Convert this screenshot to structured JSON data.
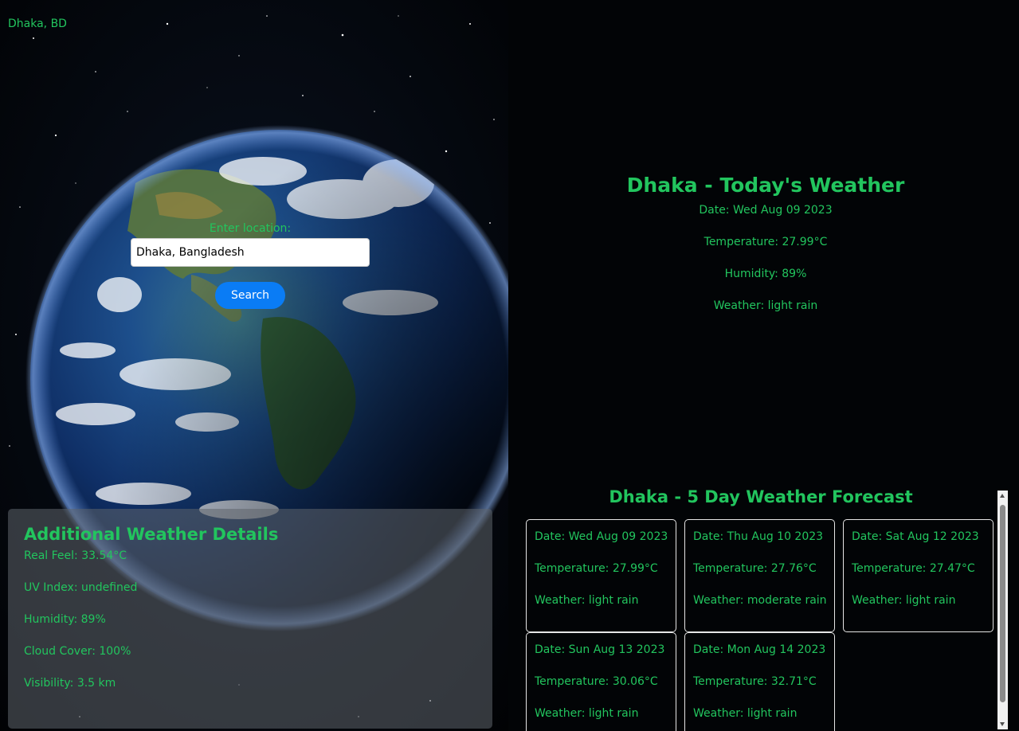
{
  "location_label": "Dhaka, BD",
  "search": {
    "prompt": "Enter location:",
    "value": "Dhaka, Bangladesh",
    "button_label": "Search"
  },
  "additional_details": {
    "title": "Additional Weather Details",
    "lines": [
      "Real Feel: 33.54°C",
      "UV Index: undefined",
      "Humidity: 89%",
      "Cloud Cover: 100%",
      "Visibility: 3.5 km"
    ]
  },
  "today": {
    "title": "Dhaka - Today's Weather",
    "date": "Date: Wed Aug 09 2023",
    "temperature": "Temperature: 27.99°C",
    "humidity": "Humidity: 89%",
    "weather": "Weather: light rain"
  },
  "forecast": {
    "title": "Dhaka - 5 Day Weather Forecast",
    "days": [
      {
        "date": "Date: Wed Aug 09 2023",
        "temperature": "Temperature: 27.99°C",
        "weather": "Weather: light rain"
      },
      {
        "date": "Date: Thu Aug 10 2023",
        "temperature": "Temperature: 27.76°C",
        "weather": "Weather: moderate rain"
      },
      {
        "date": "Date: Sat Aug 12 2023",
        "temperature": "Temperature: 27.47°C",
        "weather": "Weather: light rain"
      },
      {
        "date": "Date: Sun Aug 13 2023",
        "temperature": "Temperature: 30.06°C",
        "weather": "Weather: light rain"
      },
      {
        "date": "Date: Mon Aug 14 2023",
        "temperature": "Temperature: 32.71°C",
        "weather": "Weather: light rain"
      }
    ]
  },
  "colors": {
    "accent_green": "#22c55e",
    "button_blue": "#0a7cf5",
    "background": "#020406"
  }
}
